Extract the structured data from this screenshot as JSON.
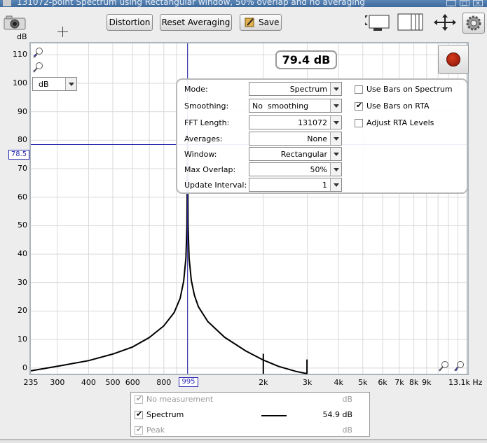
{
  "window": {
    "title": "131072-point Spectrum using Rectangular window, 50% overlap and no averaging"
  },
  "toolbar": {
    "distortion_label": "Distortion",
    "reset_label": "Reset Averaging",
    "save_label": "Save"
  },
  "graph": {
    "y_unit": "dB",
    "unit_select": "dB",
    "readout": "79.4 dB",
    "cursor_y": "78.5",
    "cursor_x": "995"
  },
  "settings": {
    "mode_label": "Mode:",
    "mode_value": "Spectrum",
    "smoothing_label": "Smoothing:",
    "smoothing_value": "No  smoothing",
    "fft_label": "FFT Length:",
    "fft_value": "131072",
    "averages_label": "Averages:",
    "averages_value": "None",
    "window_label": "Window:",
    "window_value": "Rectangular",
    "overlap_label": "Max Overlap:",
    "overlap_value": "50%",
    "update_label": "Update Interval:",
    "update_value": "1",
    "bars_spectrum_label": "Use Bars on Spectrum",
    "bars_spectrum_checked": false,
    "bars_rta_label": "Use Bars on RTA",
    "bars_rta_checked": true,
    "adjust_rta_label": "Adjust RTA Levels",
    "adjust_rta_checked": false
  },
  "legend": {
    "items": [
      {
        "name": "No measurement",
        "value": "",
        "unit": "dB",
        "checked": true
      },
      {
        "name": "Spectrum",
        "value": "54.9",
        "unit": "dB",
        "checked": true
      },
      {
        "name": "Peak",
        "value": "",
        "unit": "dB",
        "checked": true
      }
    ]
  },
  "chart_data": {
    "type": "line",
    "ylabel": "dB",
    "x_scale": "log",
    "xlim": [
      235,
      13100
    ],
    "ylim": [
      -2,
      114
    ],
    "y_ticks": [
      "110",
      "100",
      "90",
      "80",
      "70",
      "60",
      "50",
      "40",
      "30",
      "20",
      "10",
      "0"
    ],
    "x_ticks": [
      "235",
      "300",
      "400",
      "500",
      "600",
      "800",
      "2k",
      "3k",
      "4k",
      "5k",
      "6k",
      "7k",
      "8k",
      "9k",
      "13.1k Hz"
    ],
    "grid": true,
    "series": [
      {
        "name": "Spectrum",
        "x": [
          235,
          300,
          400,
          500,
          600,
          700,
          800,
          880,
          930,
          960,
          980,
          990,
          995,
          1000,
          1010,
          1030,
          1060,
          1100,
          1200,
          1400,
          1700,
          2000,
          2300,
          2700,
          3000
        ],
        "y": [
          -1,
          0.6,
          2.6,
          4.9,
          7.4,
          10.7,
          14.8,
          19.5,
          24.5,
          30.5,
          38.5,
          50,
          79.4,
          50,
          38.5,
          30.8,
          25.6,
          21.5,
          16.3,
          10.8,
          6.0,
          2.8,
          0.6,
          -1.2,
          -2
        ]
      }
    ],
    "spikes": [
      {
        "x": 2000,
        "y": 5
      },
      {
        "x": 2990,
        "y": 3
      }
    ]
  }
}
